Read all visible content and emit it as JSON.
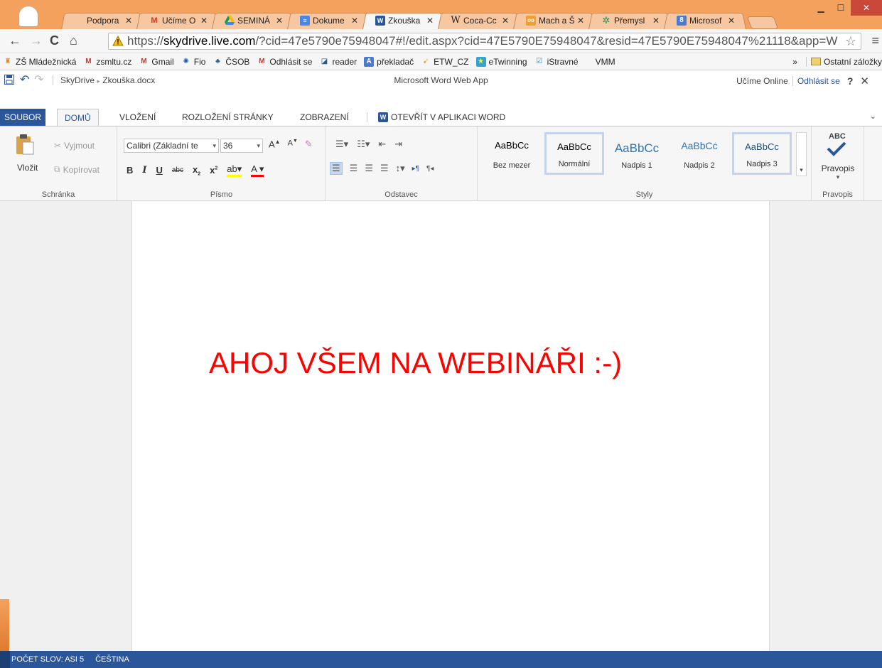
{
  "browser": {
    "tabs": [
      {
        "title": "Podpora",
        "favicon": "blank-page-icon",
        "active": false
      },
      {
        "title": "Učíme O",
        "favicon": "gmail-icon",
        "active": false
      },
      {
        "title": "SEMINÁ",
        "favicon": "drive-icon",
        "active": false
      },
      {
        "title": "Dokume",
        "favicon": "docs-icon",
        "active": false
      },
      {
        "title": "Zkouška",
        "favicon": "word-icon",
        "active": true
      },
      {
        "title": "Coca-Cc",
        "favicon": "wikipedia-icon",
        "active": false
      },
      {
        "title": "Mach a Š",
        "favicon": "owl-icon",
        "active": false
      },
      {
        "title": "Přemysl",
        "favicon": "puzzle-icon",
        "active": false
      },
      {
        "title": "Microsof",
        "favicon": "google-plus-icon",
        "active": false
      }
    ],
    "url_prefix": "https://",
    "url_host": "skydrive.live.com",
    "url_rest": "/?cid=47e5790e75948047#!/edit.aspx?cid=47E5790E75948047&resid=47E5790E75948047%21118&app=W",
    "bookmarks": [
      {
        "label": "ZŠ Mládežnická",
        "icon": "school-icon",
        "color": "#d9822b"
      },
      {
        "label": "zsmltu.cz",
        "icon": "gmail-icon",
        "color": "#d93025"
      },
      {
        "label": "Gmail",
        "icon": "gmail-icon",
        "color": "#d93025"
      },
      {
        "label": "Fio",
        "icon": "fio-icon",
        "color": "#1f5fa8"
      },
      {
        "label": "ČSOB",
        "icon": "csob-icon",
        "color": "#1f5fa8"
      },
      {
        "label": "Odhlásit se",
        "icon": "gmail-icon",
        "color": "#d93025"
      },
      {
        "label": "reader",
        "icon": "reader-icon",
        "color": "#2b579a"
      },
      {
        "label": "překladač",
        "icon": "translate-icon",
        "color": "#4a7bd0"
      },
      {
        "label": "ETW_CZ",
        "icon": "etw-icon",
        "color": "#f0a000"
      },
      {
        "label": "eTwinning",
        "icon": "etwinning-icon",
        "color": "#36a0d8"
      },
      {
        "label": "iStravné",
        "icon": "istravne-icon",
        "color": "#2b7fd0"
      },
      {
        "label": "VMM",
        "icon": "",
        "color": ""
      }
    ],
    "bookmarks_more": "»",
    "other_bookmarks": "Ostatní záložky"
  },
  "app": {
    "breadcrumb_root": "SkyDrive",
    "breadcrumb_sep": "▸",
    "document_name": "Zkouška.docx",
    "app_title": "Microsoft Word Web App",
    "user_name": "Učíme Online",
    "signout": "Odhlásit se",
    "help": "?",
    "close": "✕"
  },
  "ribbon_tabs": {
    "file": "SOUBOR",
    "home": "DOMŮ",
    "insert": "VLOŽENÍ",
    "layout": "ROZLOŽENÍ STRÁNKY",
    "view": "ZOBRAZENÍ",
    "open_in_word": "OTEVŘÍT V APLIKACI WORD"
  },
  "ribbon": {
    "clipboard": {
      "paste": "Vložit",
      "cut": "Vyjmout",
      "copy": "Kopírovat",
      "label": "Schránka"
    },
    "font": {
      "name": "Calibri (Základní te",
      "size": "36",
      "label": "Písmo"
    },
    "paragraph": {
      "label": "Odstavec"
    },
    "styles": {
      "items": [
        {
          "preview": "AaBbCc",
          "name": "Bez mezer"
        },
        {
          "preview": "AaBbCc",
          "name": "Normální"
        },
        {
          "preview": "AaBbCc",
          "name": "Nadpis 1"
        },
        {
          "preview": "AaBbCc",
          "name": "Nadpis 2"
        },
        {
          "preview": "AaBbCc",
          "name": "Nadpis 3"
        }
      ],
      "label": "Styly"
    },
    "proofing": {
      "abc": "ABC",
      "button": "Pravopis",
      "label": "Pravopis"
    }
  },
  "document": {
    "text": "AHOJ VŠEM NA WEBINÁŘI :-)",
    "text_color": "#ff0000"
  },
  "status": {
    "word_count": "POČET SLOV: ASI 5",
    "language": "ČEŠTINA"
  },
  "colors": {
    "accent": "#2b579a",
    "chrome": "#f5a15e"
  }
}
